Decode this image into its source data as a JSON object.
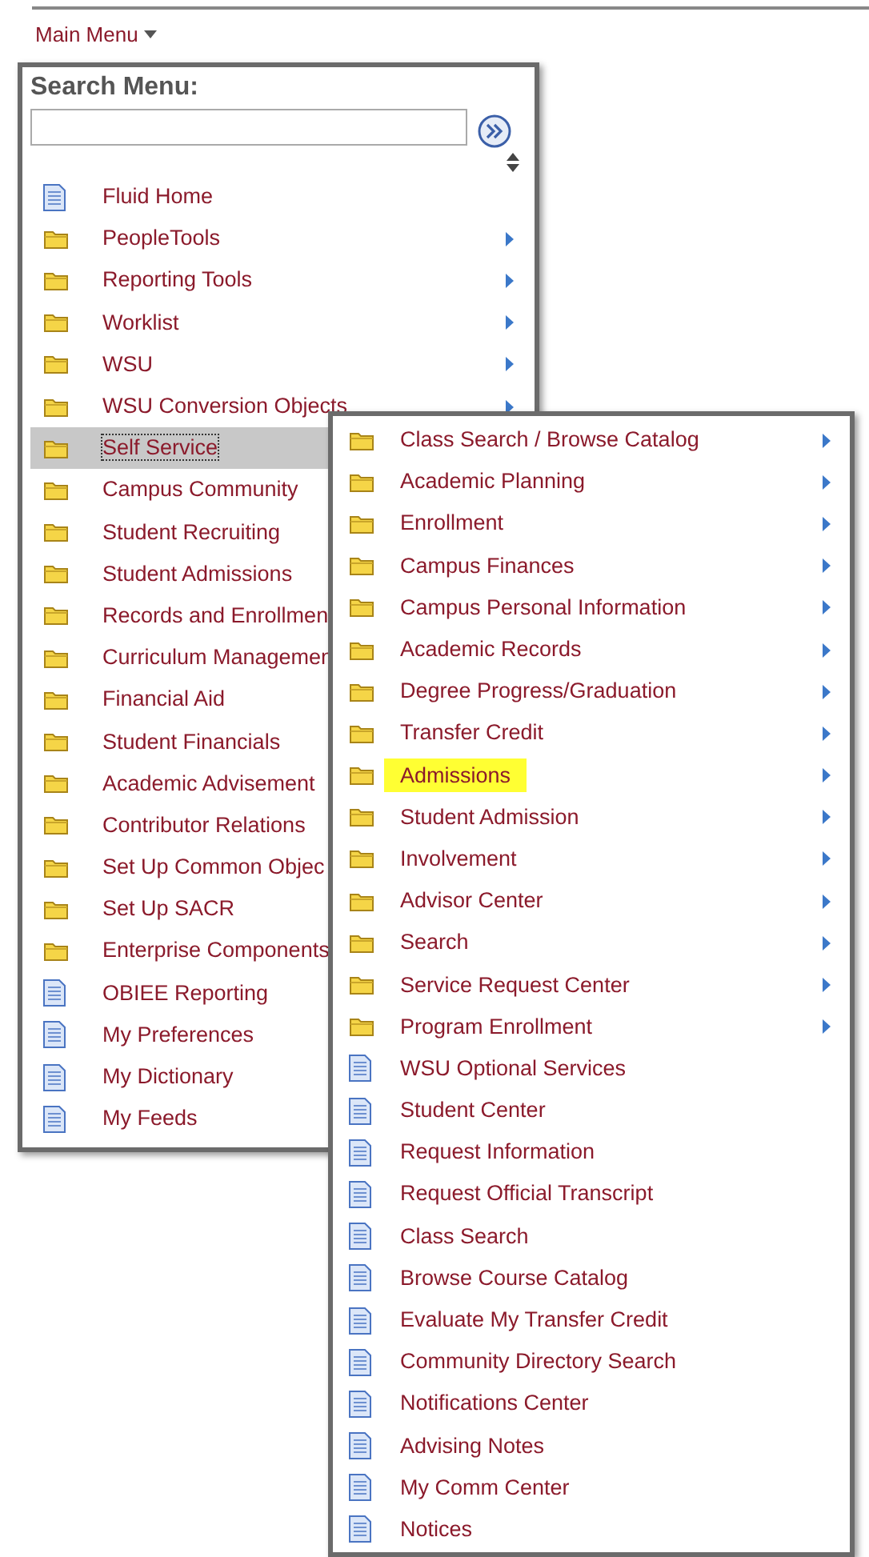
{
  "main_menu_link": {
    "label": "Main Menu"
  },
  "menu": {
    "search_label": "Search Menu:",
    "items": [
      {
        "kind": "page",
        "label": "Fluid Home",
        "submenu": false,
        "selected": false
      },
      {
        "kind": "folder",
        "label": "PeopleTools",
        "submenu": true,
        "selected": false
      },
      {
        "kind": "folder",
        "label": "Reporting Tools",
        "submenu": true,
        "selected": false
      },
      {
        "kind": "folder",
        "label": "Worklist",
        "submenu": true,
        "selected": false
      },
      {
        "kind": "folder",
        "label": "WSU",
        "submenu": true,
        "selected": false
      },
      {
        "kind": "folder",
        "label": "WSU Conversion Objects",
        "submenu": true,
        "selected": false
      },
      {
        "kind": "folder",
        "label": "Self Service",
        "submenu": false,
        "selected": true
      },
      {
        "kind": "folder",
        "label": "Campus Community",
        "submenu": false,
        "selected": false
      },
      {
        "kind": "folder",
        "label": "Student Recruiting",
        "submenu": false,
        "selected": false
      },
      {
        "kind": "folder",
        "label": "Student Admissions",
        "submenu": false,
        "selected": false
      },
      {
        "kind": "folder",
        "label": "Records and Enrollmen",
        "submenu": false,
        "selected": false
      },
      {
        "kind": "folder",
        "label": "Curriculum Managemen",
        "submenu": false,
        "selected": false
      },
      {
        "kind": "folder",
        "label": "Financial Aid",
        "submenu": false,
        "selected": false
      },
      {
        "kind": "folder",
        "label": "Student Financials",
        "submenu": false,
        "selected": false
      },
      {
        "kind": "folder",
        "label": "Academic Advisement",
        "submenu": false,
        "selected": false
      },
      {
        "kind": "folder",
        "label": "Contributor Relations",
        "submenu": false,
        "selected": false
      },
      {
        "kind": "folder",
        "label": "Set Up Common Objec",
        "submenu": false,
        "selected": false
      },
      {
        "kind": "folder",
        "label": "Set Up SACR",
        "submenu": false,
        "selected": false
      },
      {
        "kind": "folder",
        "label": "Enterprise Components",
        "submenu": false,
        "selected": false
      },
      {
        "kind": "page",
        "label": "OBIEE Reporting",
        "submenu": false,
        "selected": false
      },
      {
        "kind": "page",
        "label": "My Preferences",
        "submenu": false,
        "selected": false
      },
      {
        "kind": "page",
        "label": "My Dictionary",
        "submenu": false,
        "selected": false
      },
      {
        "kind": "page",
        "label": "My Feeds",
        "submenu": false,
        "selected": false
      }
    ]
  },
  "submenu": {
    "items": [
      {
        "kind": "folder",
        "label": "Class Search / Browse Catalog",
        "submenu": true,
        "highlighted": false
      },
      {
        "kind": "folder",
        "label": "Academic Planning",
        "submenu": true,
        "highlighted": false
      },
      {
        "kind": "folder",
        "label": "Enrollment",
        "submenu": true,
        "highlighted": false
      },
      {
        "kind": "folder",
        "label": "Campus Finances",
        "submenu": true,
        "highlighted": false
      },
      {
        "kind": "folder",
        "label": "Campus Personal Information",
        "submenu": true,
        "highlighted": false
      },
      {
        "kind": "folder",
        "label": "Academic Records",
        "submenu": true,
        "highlighted": false
      },
      {
        "kind": "folder",
        "label": "Degree Progress/Graduation",
        "submenu": true,
        "highlighted": false
      },
      {
        "kind": "folder",
        "label": "Transfer Credit",
        "submenu": true,
        "highlighted": false
      },
      {
        "kind": "folder",
        "label": "Admissions",
        "submenu": true,
        "highlighted": true
      },
      {
        "kind": "folder",
        "label": "Student Admission",
        "submenu": true,
        "highlighted": false
      },
      {
        "kind": "folder",
        "label": "Involvement",
        "submenu": true,
        "highlighted": false
      },
      {
        "kind": "folder",
        "label": "Advisor Center",
        "submenu": true,
        "highlighted": false
      },
      {
        "kind": "folder",
        "label": "Search",
        "submenu": true,
        "highlighted": false
      },
      {
        "kind": "folder",
        "label": "Service Request Center",
        "submenu": true,
        "highlighted": false
      },
      {
        "kind": "folder",
        "label": "Program Enrollment",
        "submenu": true,
        "highlighted": false
      },
      {
        "kind": "page",
        "label": "WSU Optional Services",
        "submenu": false,
        "highlighted": false
      },
      {
        "kind": "page",
        "label": "Student Center",
        "submenu": false,
        "highlighted": false
      },
      {
        "kind": "page",
        "label": "Request Information",
        "submenu": false,
        "highlighted": false
      },
      {
        "kind": "page",
        "label": "Request Official Transcript",
        "submenu": false,
        "highlighted": false
      },
      {
        "kind": "page",
        "label": "Class Search",
        "submenu": false,
        "highlighted": false
      },
      {
        "kind": "page",
        "label": "Browse Course Catalog",
        "submenu": false,
        "highlighted": false
      },
      {
        "kind": "page",
        "label": "Evaluate My Transfer Credit",
        "submenu": false,
        "highlighted": false
      },
      {
        "kind": "page",
        "label": "Community Directory Search",
        "submenu": false,
        "highlighted": false
      },
      {
        "kind": "page",
        "label": "Notifications Center",
        "submenu": false,
        "highlighted": false
      },
      {
        "kind": "page",
        "label": "Advising Notes",
        "submenu": false,
        "highlighted": false
      },
      {
        "kind": "page",
        "label": "My Comm Center",
        "submenu": false,
        "highlighted": false
      },
      {
        "kind": "page",
        "label": "Notices",
        "submenu": false,
        "highlighted": false
      }
    ]
  }
}
